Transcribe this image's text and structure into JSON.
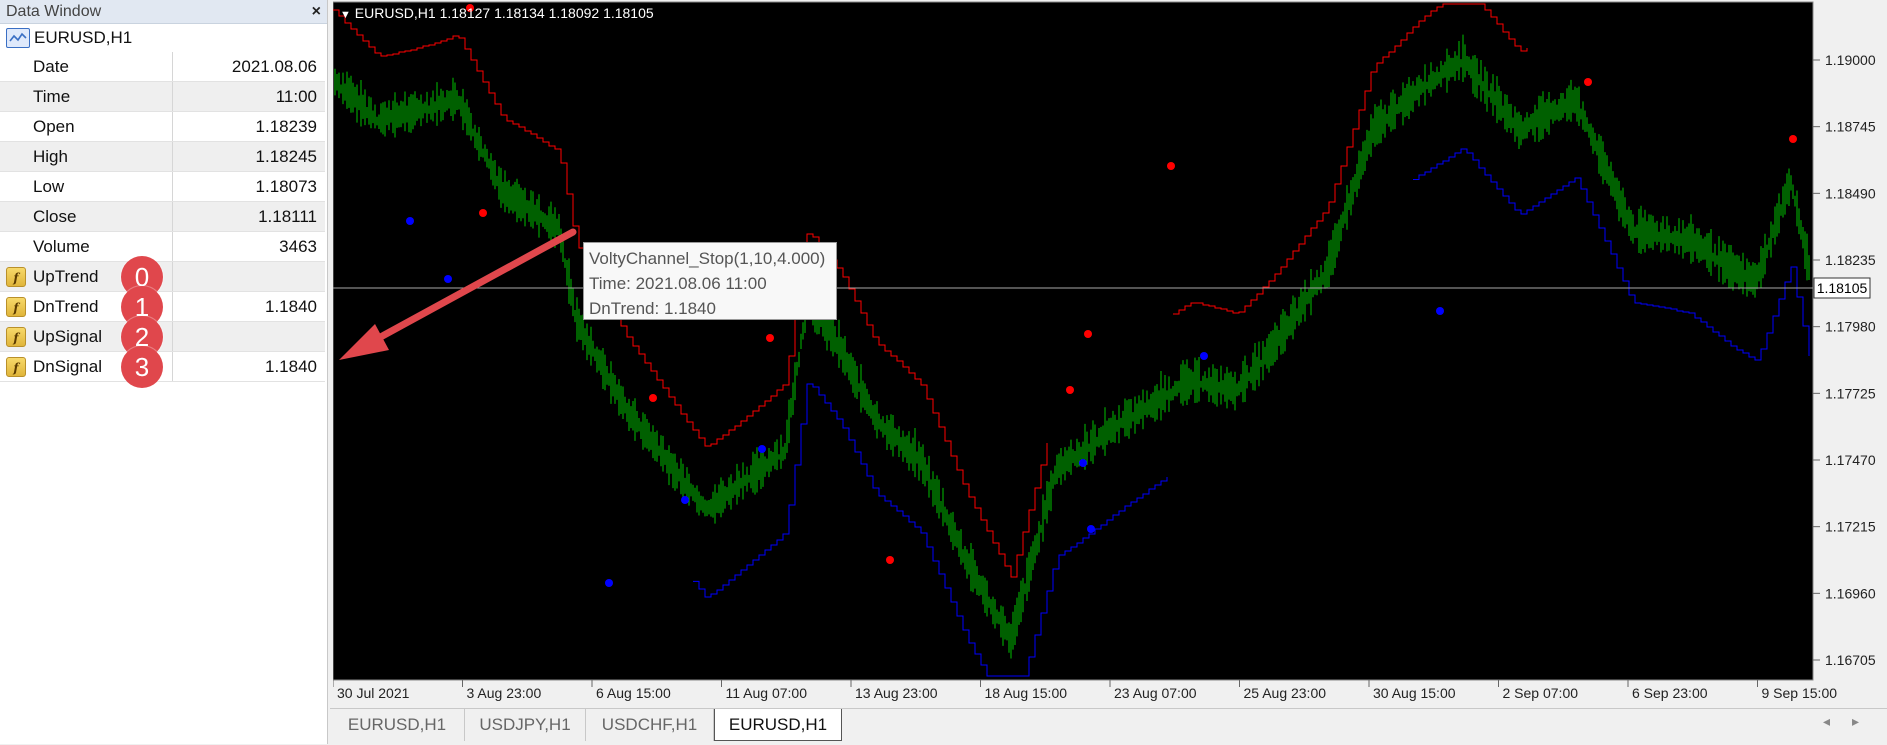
{
  "data_window": {
    "title": "Data Window",
    "close_glyph": "×",
    "symbol": "EURUSD,H1",
    "rows": [
      {
        "name": "Date",
        "value": "2021.08.06"
      },
      {
        "name": "Time",
        "value": "11:00"
      },
      {
        "name": "Open",
        "value": "1.18239"
      },
      {
        "name": "High",
        "value": "1.18245"
      },
      {
        "name": "Low",
        "value": "1.18073"
      },
      {
        "name": "Close",
        "value": "1.18111"
      },
      {
        "name": "Volume",
        "value": "3463"
      }
    ],
    "indicator_rows": [
      {
        "name": "UpTrend",
        "value": "",
        "badge": "0"
      },
      {
        "name": "DnTrend",
        "value": "1.1840",
        "badge": "1"
      },
      {
        "name": "UpSignal",
        "value": "",
        "badge": "2"
      },
      {
        "name": "DnSignal",
        "value": "1.1840",
        "badge": "3"
      }
    ],
    "fx_glyph": "f"
  },
  "chart": {
    "header": "EURUSD,H1  1.18127 1.18134 1.18092 1.18105",
    "current_price_label": "1.18105",
    "price_ticks": [
      "1.19000",
      "1.18745",
      "1.18490",
      "1.18235",
      "1.17980",
      "1.17725",
      "1.17470",
      "1.17215",
      "1.16960",
      "1.16705"
    ],
    "date_ticks": [
      "30 Jul 2021",
      "3 Aug 23:00",
      "6 Aug 15:00",
      "11 Aug 07:00",
      "13 Aug 23:00",
      "18 Aug 15:00",
      "23 Aug 07:00",
      "25 Aug 23:00",
      "30 Aug 15:00",
      "2 Sep 07:00",
      "6 Sep 23:00",
      "9 Sep 15:00"
    ],
    "colors": {
      "background": "#000000",
      "candles": "#00c000",
      "dn_trend": "#ff0000",
      "up_trend": "#0000ff",
      "arrow": "#e0474c"
    },
    "tooltip": {
      "line1": "VoltyChannel_Stop(1,10,4.000)",
      "line2": "Time: 2021.08.06 11:00",
      "line3": "DnTrend: 1.1840"
    }
  },
  "tabs": [
    {
      "label": "EURUSD,H1",
      "active": false
    },
    {
      "label": "USDJPY,H1",
      "active": false
    },
    {
      "label": "USDCHF,H1",
      "active": false
    },
    {
      "label": "EURUSD,H1",
      "active": true
    }
  ],
  "scroll_glyphs": "◂▸"
}
